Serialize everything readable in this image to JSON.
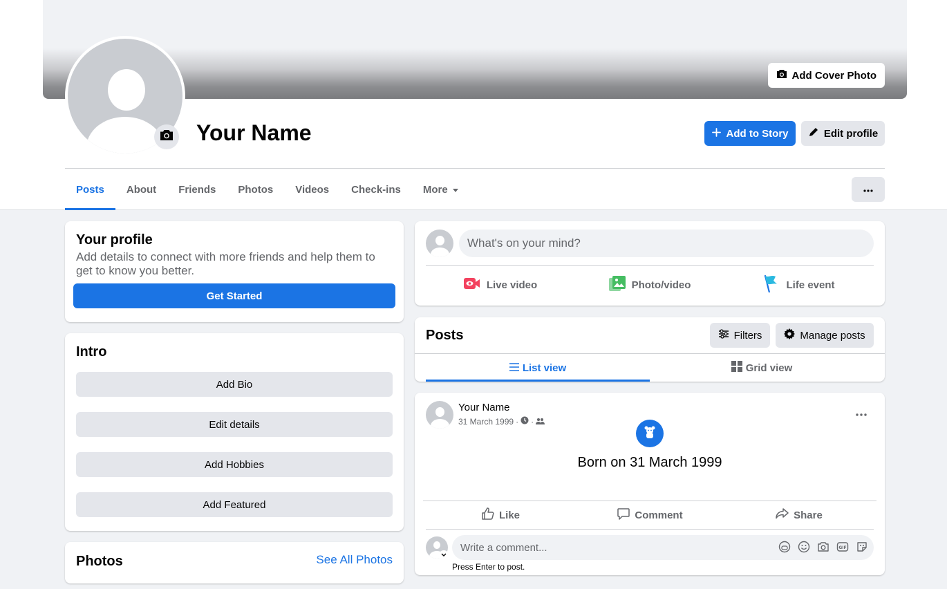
{
  "cover": {
    "add_cover_label": "Add Cover Photo"
  },
  "profile": {
    "name": "Your Name"
  },
  "actions": {
    "add_story_label": "Add to Story",
    "edit_profile_label": "Edit profile"
  },
  "tabs": [
    {
      "label": "Posts",
      "active": true
    },
    {
      "label": "About"
    },
    {
      "label": "Friends"
    },
    {
      "label": "Photos"
    },
    {
      "label": "Videos"
    },
    {
      "label": "Check-ins"
    },
    {
      "label": "More"
    }
  ],
  "your_profile": {
    "title": "Your profile",
    "description": "Add details to connect with more friends and help them to get to know you better.",
    "button": "Get Started"
  },
  "intro": {
    "title": "Intro",
    "buttons": [
      "Add Bio",
      "Edit details",
      "Add Hobbies",
      "Add Featured"
    ]
  },
  "photos": {
    "title": "Photos",
    "link": "See All Photos"
  },
  "composer": {
    "placeholder": "What's on your mind?",
    "actions": [
      {
        "label": "Live video",
        "icon": "live-video-icon",
        "color": "#f3425f"
      },
      {
        "label": "Photo/video",
        "icon": "photo-icon",
        "color": "#45bd62"
      },
      {
        "label": "Life event",
        "icon": "flag-icon",
        "color": "#1b74e4"
      }
    ]
  },
  "posts_header": {
    "title": "Posts",
    "filters_label": "Filters",
    "manage_label": "Manage posts",
    "list_view_label": "List view",
    "grid_view_label": "Grid view"
  },
  "post": {
    "author": "Your Name",
    "date": "31 March 1999",
    "life_event_text": "Born on 31 March 1999",
    "like_label": "Like",
    "comment_label": "Comment",
    "share_label": "Share",
    "comment_placeholder": "Write a comment...",
    "comment_hint": "Press Enter to post."
  },
  "colors": {
    "accent": "#1b74e4",
    "background": "#f0f2f5",
    "button_grey": "#e4e6eb"
  }
}
